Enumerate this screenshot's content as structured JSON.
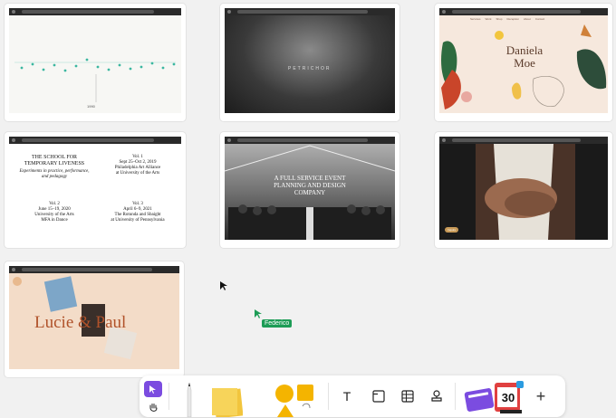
{
  "tiles": [
    {
      "id": "timeline",
      "label": "1990"
    },
    {
      "id": "clouds",
      "label": "PETRICHOR"
    },
    {
      "id": "daniela",
      "label": "Daniela Moe",
      "nav": [
        "Services",
        "Work",
        "Shop",
        "Reception",
        "About",
        "Contact"
      ]
    },
    {
      "id": "school",
      "title": "THE SCHOOL FOR TEMPORARY LIVENESS",
      "subtitle": "Experiments in practice, performance, and pedagogy",
      "vol1": {
        "h": "Vol. 1",
        "d1": "Sept 25–Oct 2, 2019",
        "d2": "Philadelphia Art Alliance",
        "d3": "at University of the Arts"
      },
      "vol2": {
        "h": "Vol. 2",
        "d1": "June 15–19, 2020",
        "d2": "University of the Arts",
        "d3": "MFA in Dance"
      },
      "vol3": {
        "h": "Vol. 3",
        "d1": "April 6–9, 2021",
        "d2": "The Rotunda and Sbaight",
        "d3": "at University of Pennsylvania"
      }
    },
    {
      "id": "event",
      "heading": "A FULL SERVICE EVENT PLANNING AND DESIGN COMPANY"
    },
    {
      "id": "hands",
      "label": "Inquire"
    },
    {
      "id": "lucie",
      "heading": "Lucie & Paul"
    }
  ],
  "collaborator": {
    "name": "Federico"
  },
  "toolbar": {
    "text_tool": "T",
    "date_day": "30",
    "plus": "+"
  },
  "colors": {
    "accent": "#7b4ce0",
    "sticky": "#f2c53d",
    "shape": "#f4b400",
    "cursor_green": "#1d9c56"
  }
}
